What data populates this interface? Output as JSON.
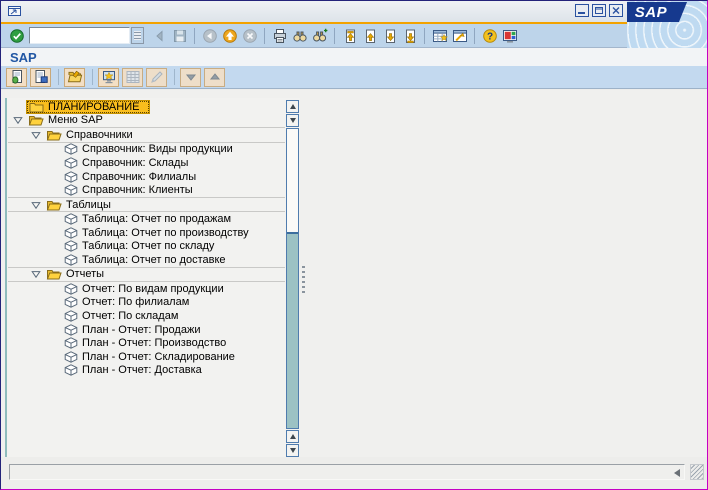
{
  "window": {
    "title": "",
    "controls": [
      {
        "name": "minimize-button"
      },
      {
        "name": "restore-button"
      },
      {
        "name": "close-button"
      }
    ]
  },
  "logo_text": "SAP",
  "page_title": "SAP",
  "system_toolbar": {
    "enter_icon": "enter-icon",
    "command_field": {
      "value": "",
      "placeholder": ""
    },
    "icons": [
      "collapse-command",
      "save",
      "|",
      "nav-back",
      "exit",
      "cancel",
      "|",
      "print",
      "find",
      "find-next",
      "|",
      "first-page",
      "prev-page",
      "next-page",
      "last-page",
      "|",
      "new-session",
      "create-shortcut",
      "|",
      "help",
      "customize"
    ],
    "disabled": [
      "collapse-command",
      "save",
      "nav-back",
      "cancel"
    ]
  },
  "app_toolbar": {
    "icons": [
      "other-menu",
      "sap-menu",
      "|",
      "create-role",
      "|",
      "assign-users",
      "documentation",
      "edit",
      "|",
      "move-down",
      "move-up"
    ],
    "disabled": [
      "documentation",
      "edit",
      "move-down",
      "move-up"
    ]
  },
  "tree": {
    "items": [
      {
        "label": "ПЛАНИРОВАНИЕ",
        "level": 0,
        "icon": "folder-closed",
        "has_expander": false,
        "expanded": false,
        "selected": true,
        "section": false
      },
      {
        "label": "Меню SAP",
        "level": 0,
        "icon": "folder-open",
        "has_expander": true,
        "expanded": true,
        "selected": false,
        "section": false
      },
      {
        "label": "Справочники",
        "level": 1,
        "icon": "folder-open",
        "has_expander": true,
        "expanded": true,
        "selected": false,
        "section": true
      },
      {
        "label": "Справочник: Виды продукции",
        "level": 2,
        "icon": "transaction",
        "has_expander": false,
        "expanded": false,
        "selected": false,
        "section": false
      },
      {
        "label": "Справочник: Склады",
        "level": 2,
        "icon": "transaction",
        "has_expander": false,
        "expanded": false,
        "selected": false,
        "section": false
      },
      {
        "label": "Справочник: Филиалы",
        "level": 2,
        "icon": "transaction",
        "has_expander": false,
        "expanded": false,
        "selected": false,
        "section": false
      },
      {
        "label": "Справочник: Клиенты",
        "level": 2,
        "icon": "transaction",
        "has_expander": false,
        "expanded": false,
        "selected": false,
        "section": false
      },
      {
        "label": "Таблицы",
        "level": 1,
        "icon": "folder-open",
        "has_expander": true,
        "expanded": true,
        "selected": false,
        "section": true
      },
      {
        "label": "Таблица: Отчет по продажам",
        "level": 2,
        "icon": "transaction",
        "has_expander": false,
        "expanded": false,
        "selected": false,
        "section": false
      },
      {
        "label": "Таблица: Отчет по производству",
        "level": 2,
        "icon": "transaction",
        "has_expander": false,
        "expanded": false,
        "selected": false,
        "section": false
      },
      {
        "label": "Таблица: Отчет по складу",
        "level": 2,
        "icon": "transaction",
        "has_expander": false,
        "expanded": false,
        "selected": false,
        "section": false
      },
      {
        "label": "Таблица: Отчет по доставке",
        "level": 2,
        "icon": "transaction",
        "has_expander": false,
        "expanded": false,
        "selected": false,
        "section": false
      },
      {
        "label": "Отчеты",
        "level": 1,
        "icon": "folder-open",
        "has_expander": true,
        "expanded": true,
        "selected": false,
        "section": true
      },
      {
        "label": "Отчет: По видам продукции",
        "level": 2,
        "icon": "transaction",
        "has_expander": false,
        "expanded": false,
        "selected": false,
        "section": false
      },
      {
        "label": "Отчет: По филиалам",
        "level": 2,
        "icon": "transaction",
        "has_expander": false,
        "expanded": false,
        "selected": false,
        "section": false
      },
      {
        "label": "Отчет: По складам",
        "level": 2,
        "icon": "transaction",
        "has_expander": false,
        "expanded": false,
        "selected": false,
        "section": false
      },
      {
        "label": "План - Отчет: Продажи",
        "level": 2,
        "icon": "transaction",
        "has_expander": false,
        "expanded": false,
        "selected": false,
        "section": false
      },
      {
        "label": "План - Отчет: Производство",
        "level": 2,
        "icon": "transaction",
        "has_expander": false,
        "expanded": false,
        "selected": false,
        "section": false
      },
      {
        "label": "План - Отчет: Складирование",
        "level": 2,
        "icon": "transaction",
        "has_expander": false,
        "expanded": false,
        "selected": false,
        "section": false
      },
      {
        "label": "План - Отчет: Доставка",
        "level": 2,
        "icon": "transaction",
        "has_expander": false,
        "expanded": false,
        "selected": false,
        "section": false
      }
    ]
  },
  "statusbar": {
    "message": ""
  },
  "colors": {
    "accent_orange": "#F2A200",
    "selection_gold": "#F9BD1D",
    "toolbar_blue": "#BDD4EA",
    "logo_navy": "#16398E",
    "scroll_track_teal": "#9CC2C4"
  }
}
